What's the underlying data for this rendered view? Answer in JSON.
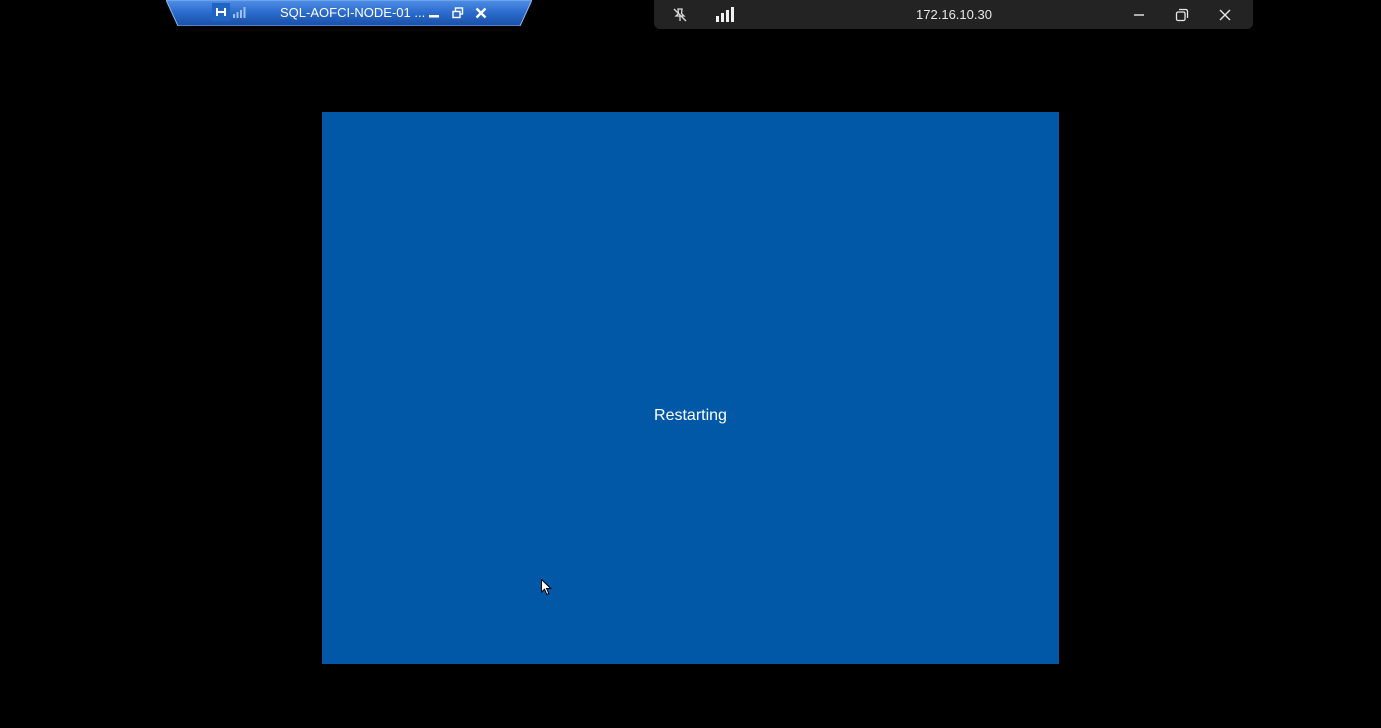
{
  "inner_connection_bar": {
    "title": "SQL-AOFCI-NODE-01 ...",
    "icons": {
      "pin": "pin-icon",
      "signal": "signal-strength-icon",
      "minimize": "minimize-icon",
      "restore": "restore-icon",
      "close": "close-icon"
    }
  },
  "outer_connection_bar": {
    "title": "172.16.10.30",
    "icons": {
      "pin": "unpinned-icon",
      "signal": "signal-strength-icon",
      "minimize": "minimize-icon",
      "restore": "restore-icon",
      "close": "close-icon"
    }
  },
  "remote_screen": {
    "status": "Restarting",
    "background_color": "#0058a7"
  },
  "colors": {
    "inner_bar": "#2d6fcf",
    "outer_bar": "#232323",
    "desktop_background": "#000000"
  }
}
